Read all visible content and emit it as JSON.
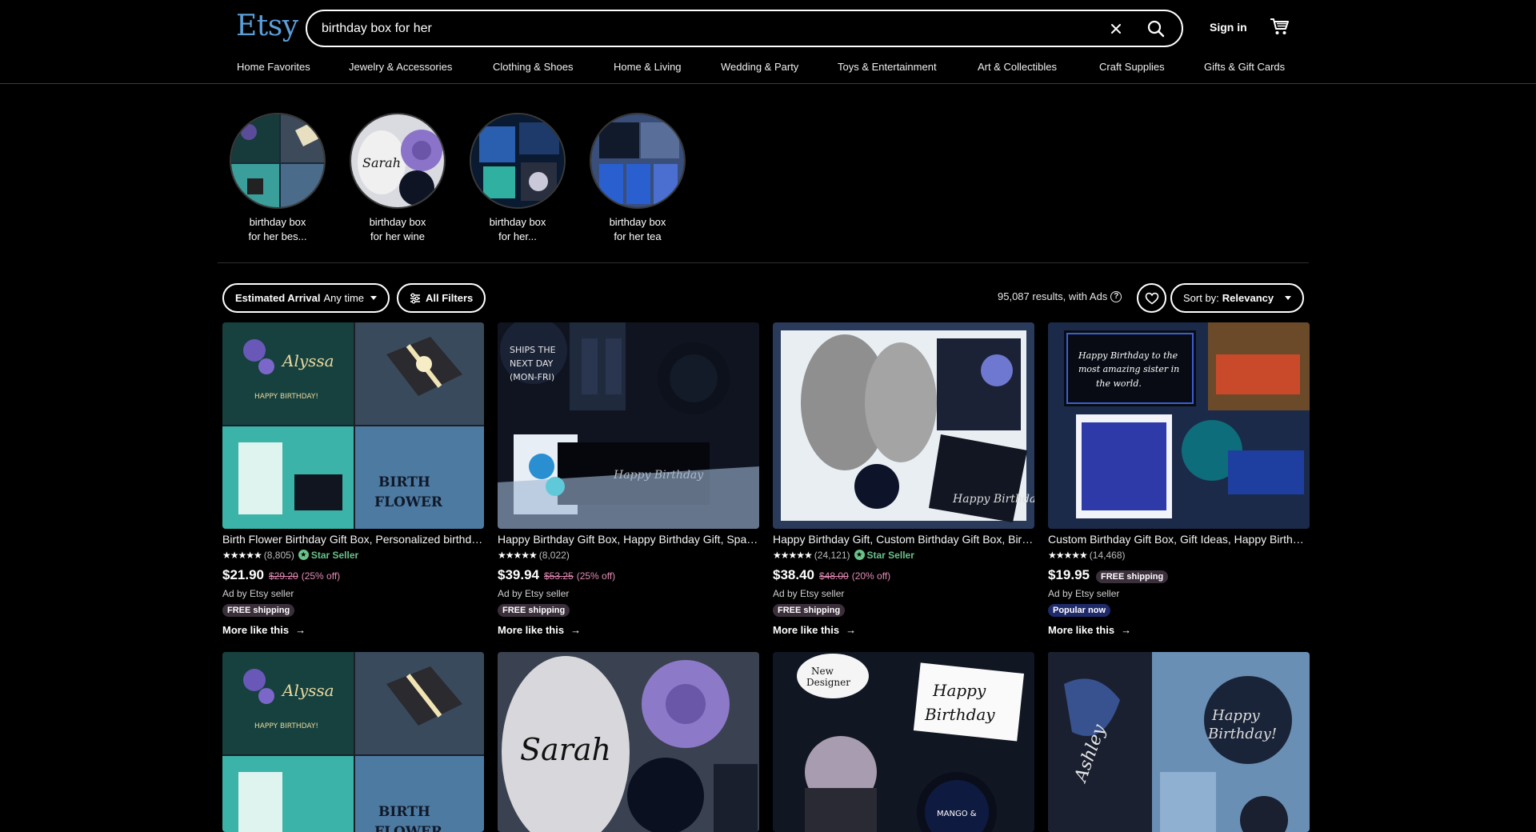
{
  "header": {
    "logo": "Etsy",
    "search": {
      "value": "birthday box for her"
    },
    "signin": "Sign in"
  },
  "nav": [
    "Home Favorites",
    "Jewelry & Accessories",
    "Clothing & Shoes",
    "Home & Living",
    "Wedding & Party",
    "Toys & Entertainment",
    "Art & Collectibles",
    "Craft Supplies",
    "Gifts & Gift Cards"
  ],
  "related": [
    {
      "line1": "birthday box",
      "line2": "for her bes..."
    },
    {
      "line1": "birthday box",
      "line2": "for her wine"
    },
    {
      "line1": "birthday box",
      "line2": "for her..."
    },
    {
      "line1": "birthday box",
      "line2": "for her tea"
    }
  ],
  "filters": {
    "arrival_label": "Estimated Arrival",
    "arrival_value": "Any time",
    "all_filters": "All Filters",
    "results": "95,087 results, with Ads",
    "sort_label": "Sort by:",
    "sort_value": "Relevancy"
  },
  "listings": [
    {
      "title": "Birth Flower Birthday Gift Box, Personalized birthday gift box for her",
      "reviews": "(8,805)",
      "star_seller": "Star Seller",
      "price": "$21.90",
      "original": "$29.20",
      "discount": "(25% off)",
      "adby": "Ad by Etsy seller",
      "badge": "FREE shipping",
      "more": "More like this"
    },
    {
      "title": "Happy Birthday Gift Box, Happy Birthday Gift, Spa Gift Box for Her",
      "reviews": "(8,022)",
      "price": "$39.94",
      "original": "$53.25",
      "discount": "(25% off)",
      "adby": "Ad by Etsy seller",
      "badge": "FREE shipping",
      "more": "More like this"
    },
    {
      "title": "Happy Birthday Gift, Custom Birthday Gift Box, Birthday Gift for Her",
      "reviews": "(24,121)",
      "star_seller": "Star Seller",
      "price": "$38.40",
      "original": "$48.00",
      "discount": "(20% off)",
      "adby": "Ad by Etsy seller",
      "badge": "FREE shipping",
      "more": "More like this"
    },
    {
      "title": "Custom Birthday Gift Box, Gift Ideas, Happy Birthday Box for Her",
      "reviews": "(14,468)",
      "price": "$19.95",
      "inline_badge": "FREE shipping",
      "adby": "Ad by Etsy seller",
      "badge": "Popular now",
      "more": "More like this"
    }
  ],
  "colors": {
    "accent": "#5a9fd9",
    "star_seller": "#6bc28a",
    "sale": "#e58bb5"
  }
}
